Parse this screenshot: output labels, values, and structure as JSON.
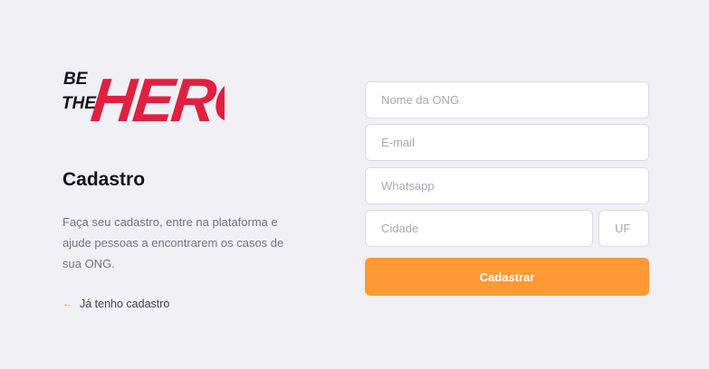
{
  "logo": {
    "text_line1": "BE",
    "text_line2": "THE",
    "text_main": "HERO",
    "color": "#e02041"
  },
  "register": {
    "title": "Cadastro",
    "description": "Faça seu cadastro, entre na plataforma e ajude pessoas a encontrarem os casos de sua ONG.",
    "back_link": "Já tenho cadastro"
  },
  "form": {
    "name_placeholder": "Nome da ONG",
    "email_placeholder": "E-mail",
    "whatsapp_placeholder": "Whatsapp",
    "city_placeholder": "Cidade",
    "uf_placeholder": "UF",
    "submit_label": "Cadastrar"
  },
  "colors": {
    "background": "#f0f0f5",
    "accent": "#ff9934",
    "brand": "#e02041"
  },
  "icons": {
    "back": "arrow-left-icon"
  }
}
